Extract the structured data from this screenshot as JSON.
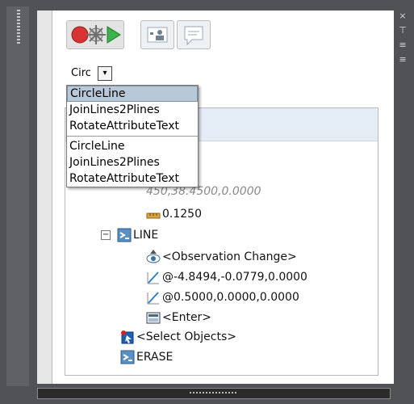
{
  "window": {
    "close_glyph": "×",
    "tool_glyphs": [
      "⊤",
      "≡",
      "≡"
    ]
  },
  "combo": {
    "value": "Circ",
    "arrow_glyph": "▾"
  },
  "dropdown": {
    "items": [
      "CircleLine",
      "JoinLines2Plines",
      "RotateAttributeText"
    ],
    "recent": [
      "CircleLine",
      "JoinLines2Plines",
      "RotateAttributeText"
    ],
    "selected_index": 0
  },
  "tree": {
    "partial_point": "450,38.4500,0.0000",
    "distance": "0.1250",
    "line_command": "LINE",
    "observation": "<Observation Change>",
    "point1": "@-4.8494,-0.0779,0.0000",
    "point2": "@0.5000,0.0000,0.0000",
    "enter": "<Enter>",
    "select_objects": "<Select Objects>",
    "erase_command": "ERASE"
  },
  "colors": {
    "frame": "#505256",
    "panel_header": "#e4edf6",
    "selection": "#b8c8d8"
  }
}
